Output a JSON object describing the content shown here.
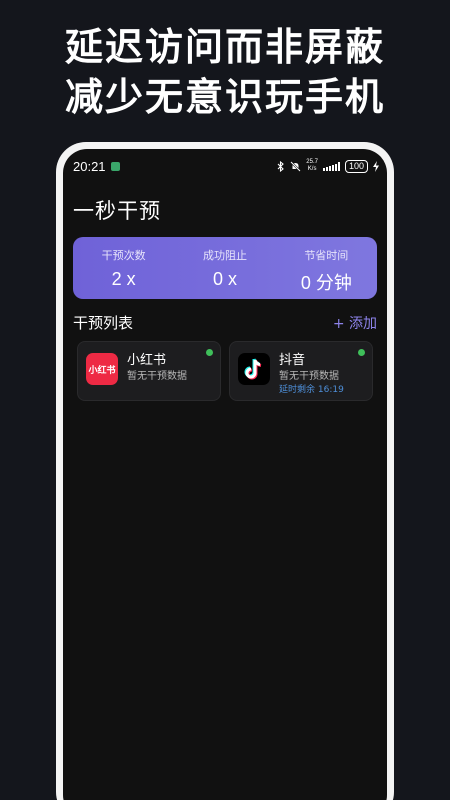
{
  "promo": {
    "line1": "延迟访问而非屏蔽",
    "line2": "减少无意识玩手机"
  },
  "status_bar": {
    "time": "20:21",
    "net_speed_value": "25.7",
    "net_speed_unit": "K/s",
    "battery": "100"
  },
  "app": {
    "title": "一秒干预"
  },
  "stats": [
    {
      "label": "干预次数",
      "value": "2 x"
    },
    {
      "label": "成功阻止",
      "value": "0 x"
    },
    {
      "label": "节省时间",
      "value": "0 分钟"
    }
  ],
  "list": {
    "title": "干预列表",
    "add_label": "+ 添加",
    "items": [
      {
        "name": "小红书",
        "icon_text": "小红书",
        "subtitle": "暂无干预数据",
        "delay": "",
        "status_color": "#3fbf5a"
      },
      {
        "name": "抖音",
        "icon_text": "",
        "subtitle": "暂无干预数据",
        "delay": "延时剩余 16:19",
        "status_color": "#3fbf5a"
      }
    ]
  },
  "colors": {
    "accent": "#7f77df",
    "link": "#8d83ea",
    "delay_text": "#4e8fd9",
    "online": "#3fbf5a"
  }
}
